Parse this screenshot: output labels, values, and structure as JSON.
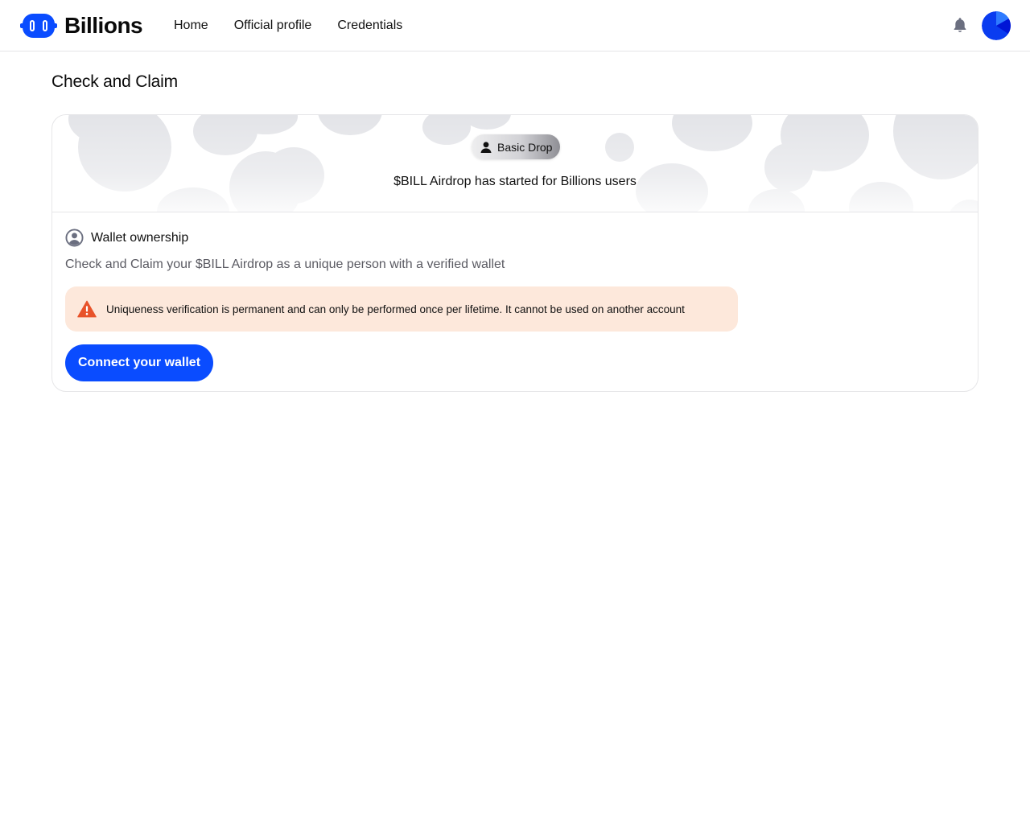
{
  "brand": {
    "name": "Billions",
    "accent": "#0a4cff"
  },
  "nav": {
    "items": [
      {
        "label": "Home"
      },
      {
        "label": "Official profile"
      },
      {
        "label": "Credentials"
      }
    ]
  },
  "header": {
    "icons": {
      "notifications": "bell-icon",
      "avatar": "avatar"
    }
  },
  "page": {
    "title": "Check and Claim"
  },
  "card": {
    "badge": {
      "label": "Basic Drop",
      "icon": "user-icon"
    },
    "hero_text": "$BILL Airdrop has started for Billions users",
    "section": {
      "title": "Wallet ownership",
      "icon": "person-circle-icon",
      "description": "Check and Claim your $BILL Airdrop as a unique person with a verified wallet"
    },
    "warning": {
      "text": "Uniqueness verification is permanent and can only be performed once per lifetime. It cannot be used on another account",
      "icon": "warning-triangle-icon",
      "color": "#e8532a",
      "background": "#fde8db"
    },
    "cta": {
      "label": "Connect your wallet"
    }
  }
}
